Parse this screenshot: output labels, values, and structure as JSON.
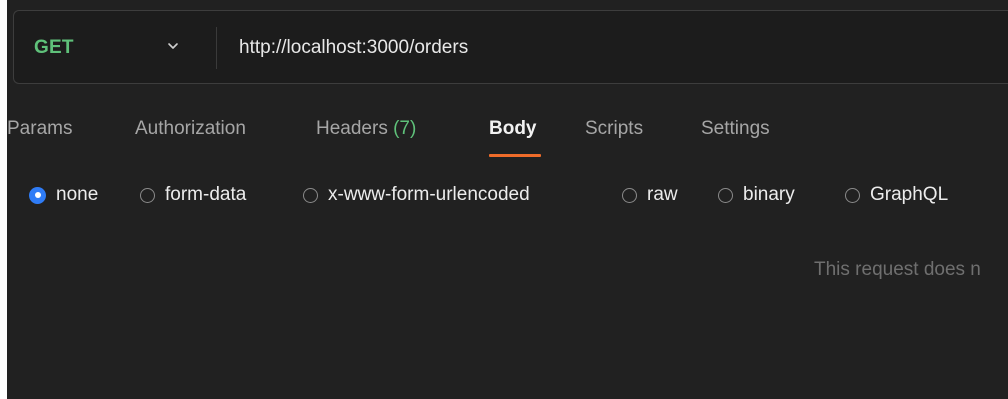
{
  "request": {
    "method": "GET",
    "url": "http://localhost:3000/orders"
  },
  "tabs": [
    {
      "label": "Params"
    },
    {
      "label": "Authorization"
    },
    {
      "label": "Headers",
      "count": "(7)"
    },
    {
      "label": "Body",
      "active": true
    },
    {
      "label": "Scripts"
    },
    {
      "label": "Settings"
    }
  ],
  "body_types": [
    {
      "label": "none",
      "checked": true
    },
    {
      "label": "form-data"
    },
    {
      "label": "x-www-form-urlencoded"
    },
    {
      "label": "raw"
    },
    {
      "label": "binary"
    },
    {
      "label": "GraphQL"
    }
  ],
  "empty_message": "This request does n",
  "colors": {
    "method_get": "#5fc17a",
    "active_tab_underline": "#ef6c2a",
    "radio_checked": "#2f7cf6",
    "background": "#212121"
  },
  "icons": {
    "method_dropdown": "chevron-down-icon"
  }
}
